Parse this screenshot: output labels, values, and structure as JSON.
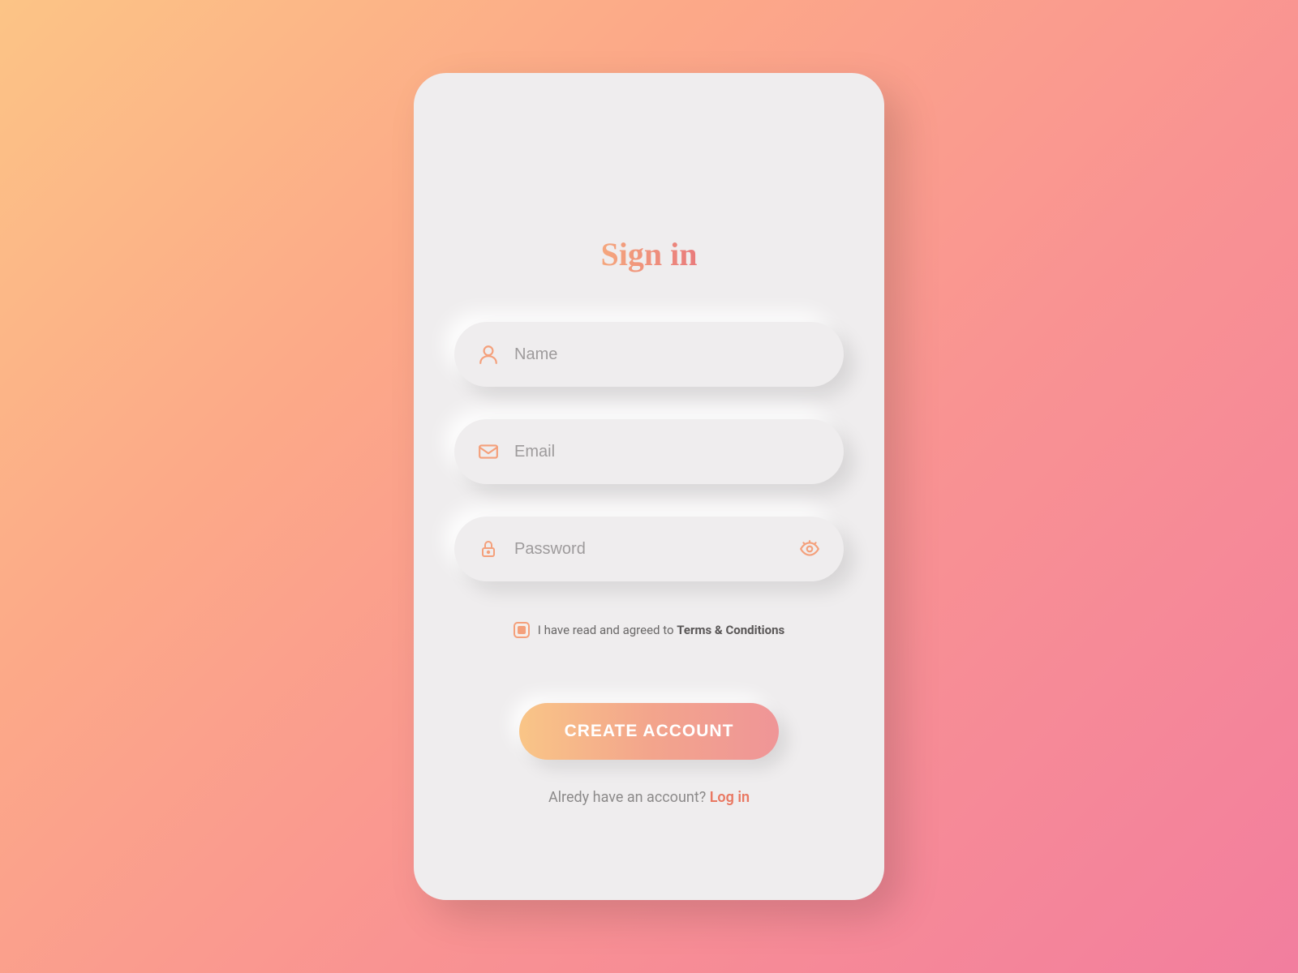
{
  "title": "Sign in",
  "fields": {
    "name": {
      "placeholder": "Name",
      "value": ""
    },
    "email": {
      "placeholder": "Email",
      "value": ""
    },
    "password": {
      "placeholder": "Password",
      "value": ""
    }
  },
  "terms": {
    "checked": true,
    "prefix": "I have read and agreed to ",
    "link": "Terms & Conditions"
  },
  "button": {
    "label": "CREATE ACCOUNT"
  },
  "footer": {
    "prefix": "Alredy have an account? ",
    "link": "Log in"
  },
  "colors": {
    "accent": "#f4a07b",
    "gradient_start": "#fcc486",
    "gradient_end": "#f27e9e"
  }
}
